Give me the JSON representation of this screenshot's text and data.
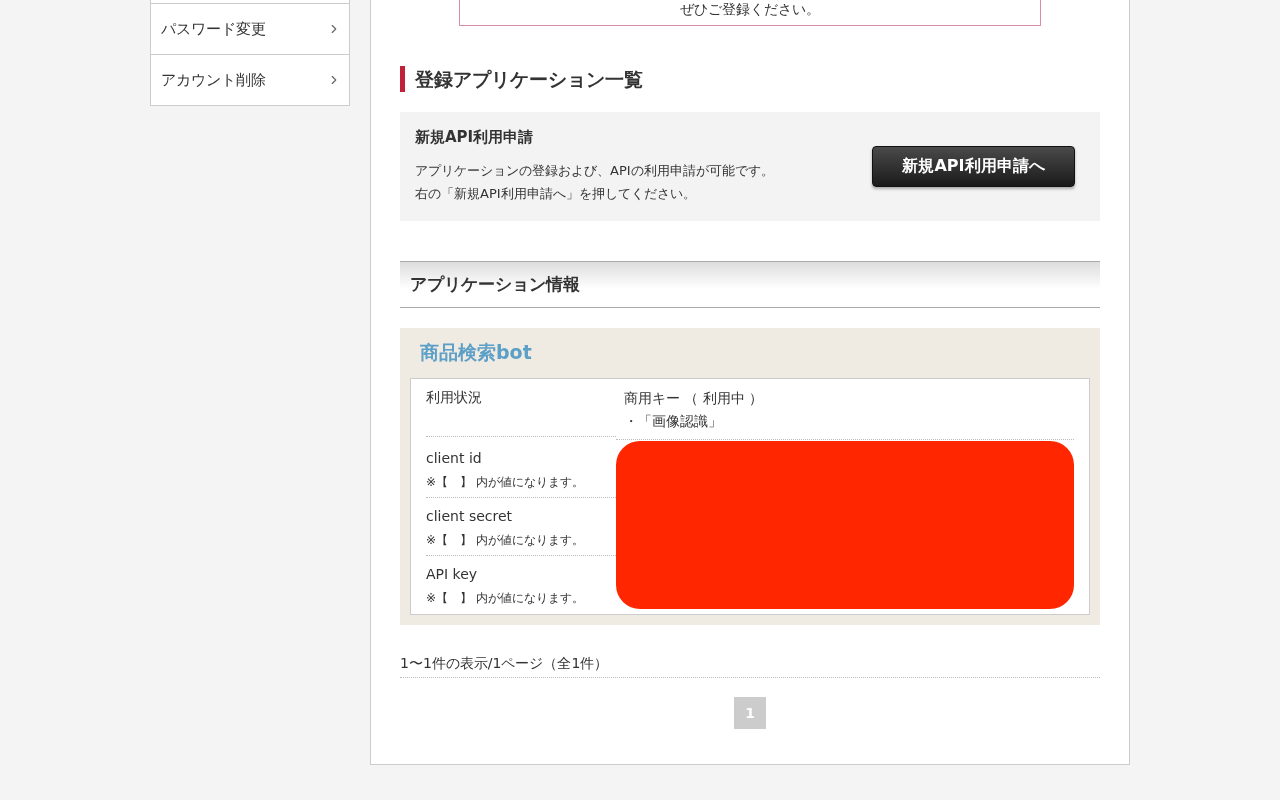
{
  "sidebar": {
    "items": [
      {
        "label": "パスワード変更"
      },
      {
        "label": "アカウント削除"
      }
    ]
  },
  "notice": {
    "text": "ぜひご登録ください。"
  },
  "registered_apps": {
    "heading": "登録アプリケーション一覧",
    "apply_title": "新規API利用申請",
    "apply_lines": [
      "アプリケーションの登録および、APIの利用申請が可能です。",
      "右の「新規API利用申請へ」を押してください。"
    ],
    "apply_button": "新規API利用申請へ"
  },
  "app_info": {
    "heading": "アプリケーション情報",
    "app_name": "商品検索bot",
    "status_label": "利用状況",
    "status_lines": [
      "商用キー （ 利用中 ）",
      "・「画像認識」"
    ],
    "fields": [
      {
        "label": "client id",
        "note": "※【　】 内が値になります。"
      },
      {
        "label": "client secret",
        "note": "※【　】 内が値になります。"
      },
      {
        "label": "API key",
        "note": "※【　】 内が値になります。"
      }
    ]
  },
  "pagination": {
    "summary": "1〜1件の表示/1ページ（全1件）",
    "pages": [
      {
        "label": "1",
        "selected": true
      }
    ]
  }
}
